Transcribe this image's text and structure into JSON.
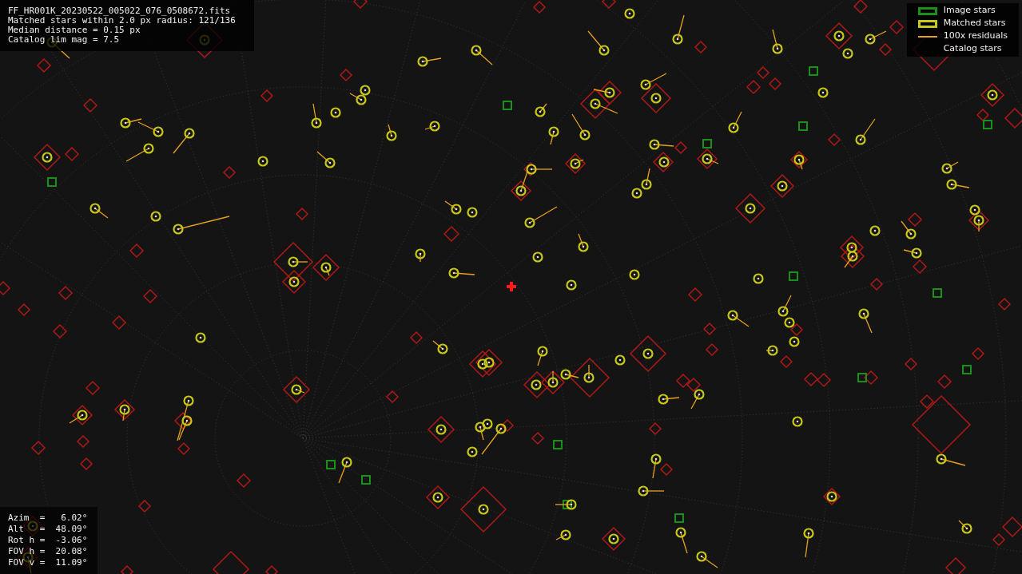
{
  "header": {
    "lines": [
      "FF_HR001K_20230522_005022_076_0508672.fits",
      "Matched stars within 2.0 px radius: 121/136",
      "Median distance = 0.15 px",
      "Catalog lim mag = 7.5"
    ]
  },
  "legend": [
    {
      "label": "Image stars",
      "kind": "box",
      "color": "#1a8f1a"
    },
    {
      "label": "Matched stars",
      "kind": "box",
      "color": "#c8c81a"
    },
    {
      "label": "100x residuals",
      "kind": "line",
      "color": "#e8a020"
    },
    {
      "label": "Catalog stars",
      "kind": "blank"
    }
  ],
  "pointing": [
    {
      "label": "Azim  =",
      "value": "  6.02°"
    },
    {
      "label": "Alt   =",
      "value": " 48.09°"
    },
    {
      "label": "Rot h =",
      "value": " -3.06°"
    },
    {
      "label": "FOV h =",
      "value": " 20.08°"
    },
    {
      "label": "FOV v =",
      "value": " 11.09°"
    }
  ]
}
